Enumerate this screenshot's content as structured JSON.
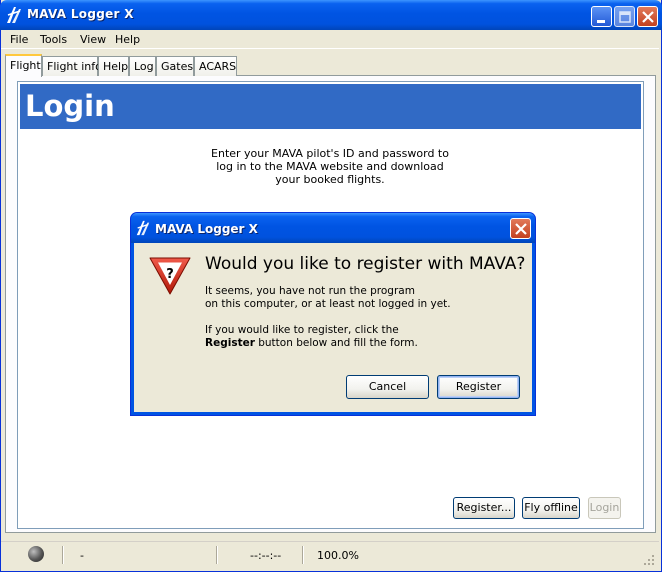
{
  "window": {
    "title": "MAVA Logger X"
  },
  "menu": [
    "File",
    "Tools",
    "View",
    "Help"
  ],
  "tabs": [
    "Flight",
    "Flight info",
    "Help",
    "Log",
    "Gates",
    "ACARS"
  ],
  "login": {
    "title": "Login",
    "intro_lines": [
      "Enter your MAVA pilot's ID and password to",
      "log in to the MAVA website and download",
      "your booked flights."
    ],
    "register_label": "Register...",
    "fly_offline_label": "Fly offline",
    "login_label": "Login"
  },
  "dialog": {
    "title": "MAVA Logger X",
    "heading": "Would you like to register with MAVA?",
    "para1_line1": "It seems, you have not run the program",
    "para1_line2": "on this computer, or at least not logged in yet.",
    "para2_line1": "If you would like to register, click the",
    "para2_bold": "Register",
    "para2_line2_rest": " button below and fill the form.",
    "cancel_label": "Cancel",
    "register_label": "Register"
  },
  "status": {
    "field1": "-",
    "time": "--:--:--",
    "zoom": "100.0%"
  },
  "colors": {
    "titlebar": "#0054e3",
    "header": "#316ac5",
    "face": "#ece9d8"
  }
}
